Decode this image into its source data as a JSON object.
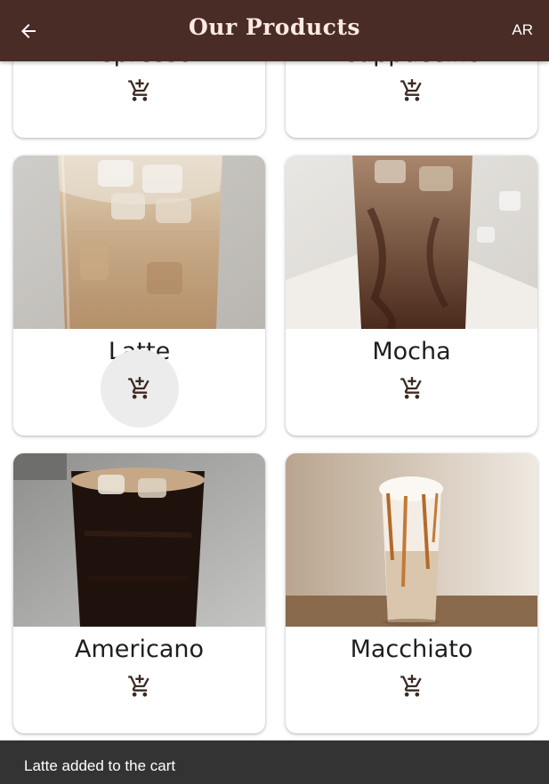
{
  "appbar": {
    "title": "Our Products",
    "language_label": "AR",
    "back_icon": "arrow-left-icon"
  },
  "products": [
    {
      "name": "Espresso"
    },
    {
      "name": "Cappuccino"
    },
    {
      "name": "Latte"
    },
    {
      "name": "Mocha"
    },
    {
      "name": "Americano"
    },
    {
      "name": "Macchiato"
    }
  ],
  "cart_icon": "add-shopping-cart-icon",
  "snackbar": {
    "message": "Latte added to the cart"
  },
  "colors": {
    "appbar": "#4a2c26",
    "title": "#fbe9e2",
    "snackbar": "#333333"
  }
}
